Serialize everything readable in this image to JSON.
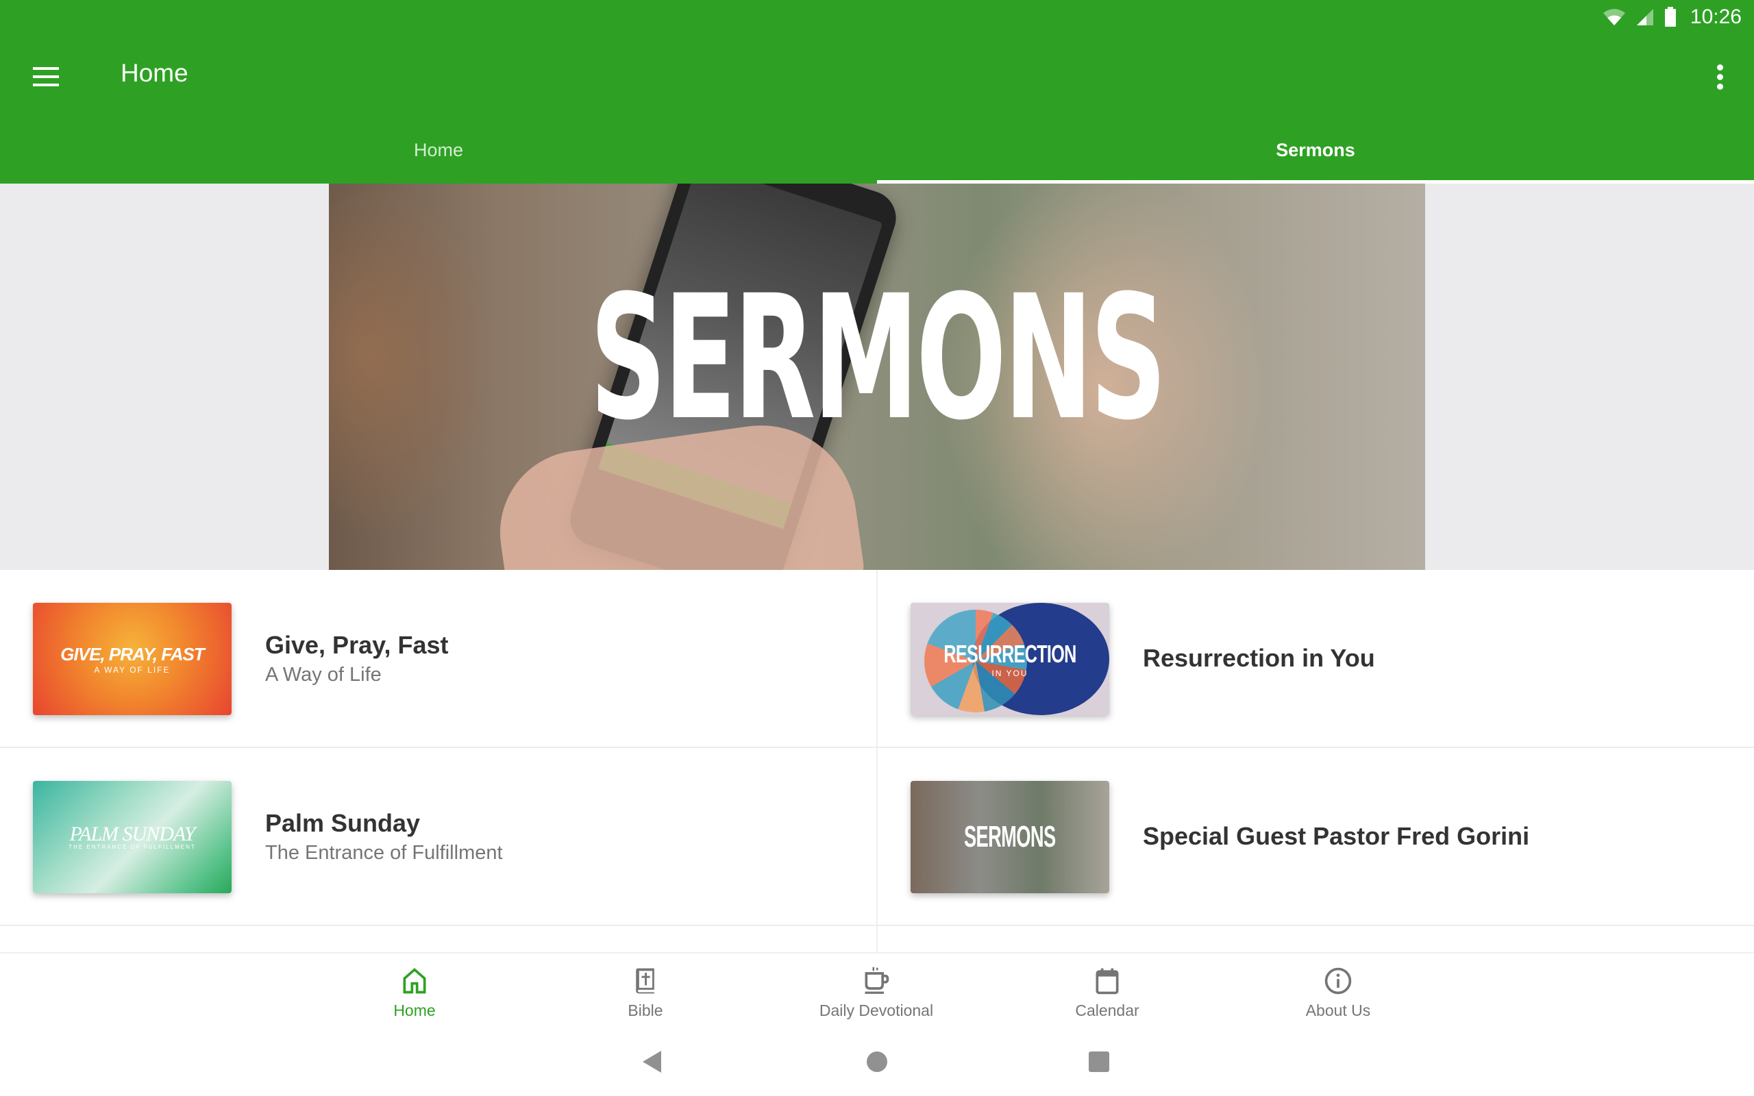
{
  "status_bar": {
    "time": "10:26",
    "icons": [
      "wifi-icon",
      "cell-signal-icon",
      "battery-icon"
    ]
  },
  "toolbar": {
    "menu_icon": "hamburger-menu-icon",
    "title": "Home",
    "overflow_icon": "more-vert-icon"
  },
  "tabs": [
    {
      "label": "Home",
      "active": false
    },
    {
      "label": "Sermons",
      "active": true
    }
  ],
  "banner": {
    "title": "SERMONS"
  },
  "sermons": [
    {
      "title": "Give, Pray, Fast",
      "subtitle": "A Way of Life",
      "thumb_text": "GIVE, PRAY, FAST",
      "thumb_sub": "A WAY OF LIFE"
    },
    {
      "title": "Resurrection in You",
      "subtitle": "",
      "thumb_text": "RESURRECTION",
      "thumb_sub": "IN YOU"
    },
    {
      "title": "Palm Sunday",
      "subtitle": "The Entrance of Fulfillment",
      "thumb_text": "PALM SUNDAY",
      "thumb_sub": "THE ENTRANCE OF FULFILLMENT"
    },
    {
      "title": "Special Guest Pastor Fred Gorini",
      "subtitle": "",
      "thumb_text": "SERMONS",
      "thumb_sub": ""
    }
  ],
  "bottom_nav": [
    {
      "label": "Home",
      "icon": "home-icon",
      "active": true
    },
    {
      "label": "Bible",
      "icon": "bible-icon",
      "active": false
    },
    {
      "label": "Daily Devotional",
      "icon": "coffee-cup-icon",
      "active": false
    },
    {
      "label": "Calendar",
      "icon": "calendar-icon",
      "active": false
    },
    {
      "label": "About Us",
      "icon": "info-icon",
      "active": false
    }
  ],
  "system_nav": [
    "back",
    "home",
    "recents"
  ],
  "colors": {
    "primary": "#2ea124",
    "inactive": "#757575",
    "title_text": "#333333"
  }
}
